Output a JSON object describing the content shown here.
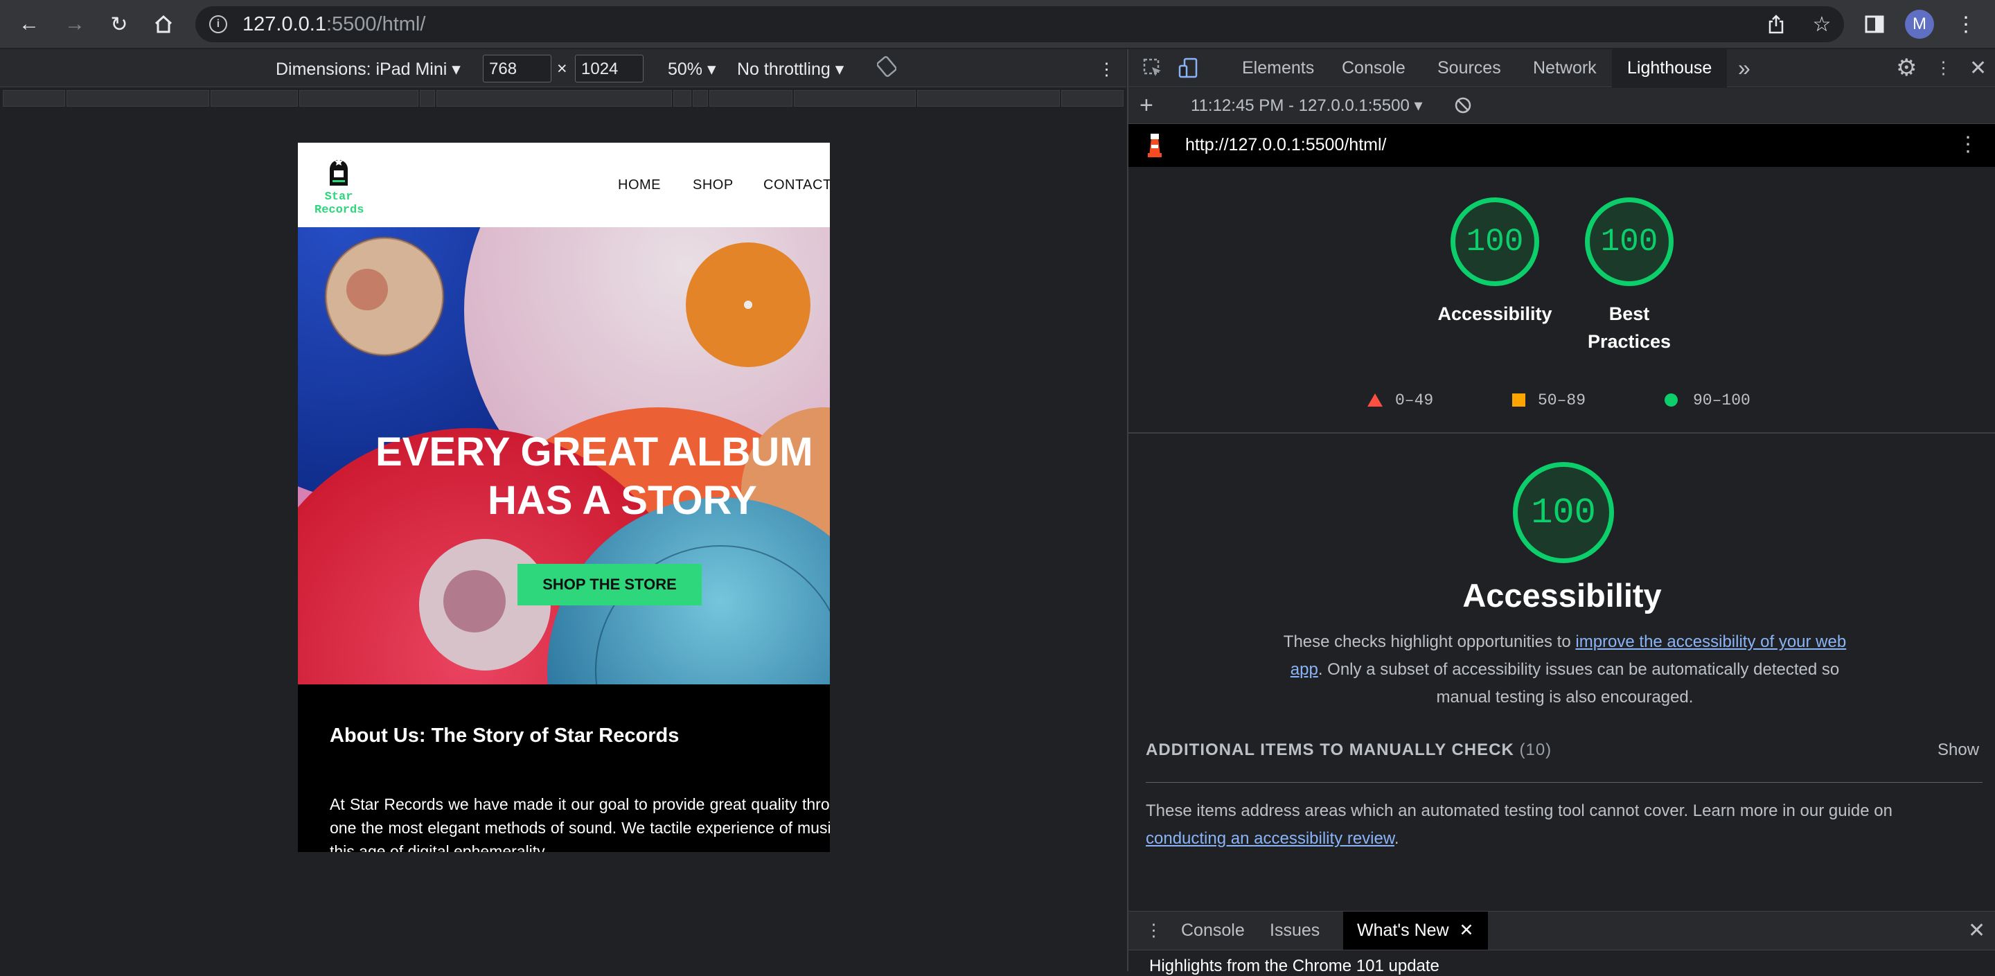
{
  "browser": {
    "url_host": "127.0.0.1",
    "url_path": ":5500/html/",
    "avatar_letter": "M"
  },
  "device_toolbar": {
    "dimensions_label": "Dimensions: iPad Mini",
    "width_value": "768",
    "times": "×",
    "height_value": "1024",
    "zoom": "50%",
    "throttling": "No throttling"
  },
  "site": {
    "logo_line1": "Star",
    "logo_line2": "Records",
    "nav": [
      "HOME",
      "SHOP",
      "CONTACT"
    ],
    "hero_line1": "EVERY GREAT ALBUM",
    "hero_line2": "HAS A STORY",
    "cta": "SHOP THE STORE",
    "about_title": "About Us: The Story of Star Records",
    "about_text": "At Star Records we have made it our goal to provide great quality through one the most elegant methods of sound. We tactile experience of music in this age of digital ephemerality"
  },
  "devtools": {
    "tabs": [
      "Elements",
      "Console",
      "Sources",
      "Network",
      "Lighthouse"
    ],
    "more": "»",
    "report_time": "11:12:45 PM - 127.0.0.1:5500",
    "report_url": "http://127.0.0.1:5500/html/",
    "scores": [
      {
        "value": "100",
        "label": "Accessibility"
      },
      {
        "value": "100",
        "label_line1": "Best",
        "label_line2": "Practices"
      }
    ],
    "legend": [
      "0–49",
      "50–89",
      "90–100"
    ],
    "main_score": "100",
    "main_title": "Accessibility",
    "desc_before": "These checks highlight opportunities to ",
    "desc_link": "improve the accessibility of your web app",
    "desc_after": ". Only a subset of accessibility issues can be automatically detected so manual testing is also encouraged.",
    "manual_title": "ADDITIONAL ITEMS TO MANUALLY CHECK",
    "manual_count": "(10)",
    "show": "Show",
    "manual_before": "These items address areas which an automated testing tool cannot cover. Learn more in our guide on ",
    "manual_link": "conducting an accessibility review",
    "manual_after": ".",
    "drawer_tabs": [
      "Console",
      "Issues",
      "What's New"
    ],
    "drawer_text": "Highlights from the Chrome 101 update"
  },
  "colors": {
    "accent_green": "#0cce6b",
    "cta_green": "#2ed67c",
    "fail_red": "#ff4e42",
    "average_orange": "#ffa400",
    "link_blue": "#8ab4f8"
  }
}
